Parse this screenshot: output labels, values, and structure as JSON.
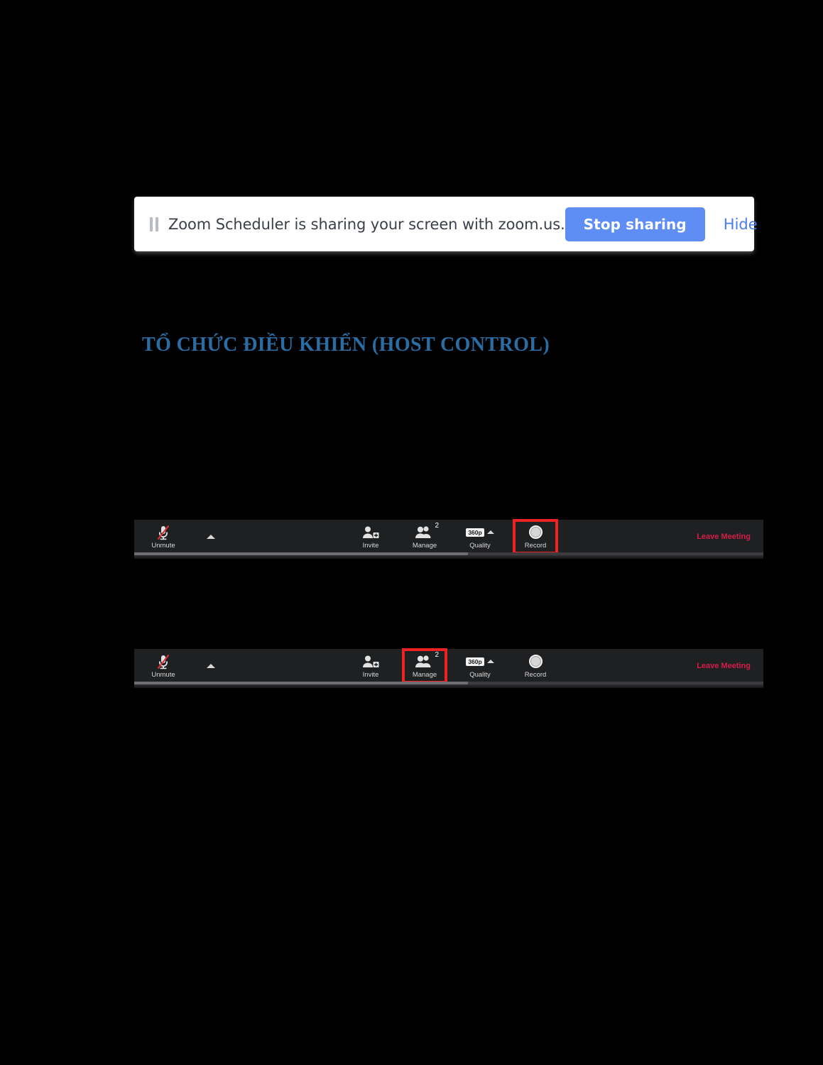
{
  "share_banner": {
    "pause_icon": "pause-icon",
    "message": "Zoom Scheduler is sharing your screen with zoom.us.",
    "stop_label": "Stop sharing",
    "hide_label": "Hide",
    "button_color": "#5e8df4",
    "link_color": "#4b7cf0"
  },
  "heading": {
    "text": "TỔ CHỨC ĐIỀU KHIỂN (HOST CONTROL)",
    "color": "#2b6ca3"
  },
  "toolbars": [
    {
      "id": "toolbar-record-highlighted",
      "highlighted": "Record",
      "items": [
        {
          "label": "Unmute",
          "icon": "microphone-muted-icon"
        },
        {
          "label": "Invite",
          "icon": "person-add-icon"
        },
        {
          "label": "Manage",
          "icon": "participants-icon",
          "badge": "2"
        },
        {
          "label": "Quality",
          "icon": "quality-icon",
          "value": "360p"
        },
        {
          "label": "Record",
          "icon": "record-icon"
        }
      ],
      "leave_label": "Leave Meeting",
      "leave_color": "#d31e4a",
      "highlight_color": "#ee2222"
    },
    {
      "id": "toolbar-manage-highlighted",
      "highlighted": "Manage",
      "items": [
        {
          "label": "Unmute",
          "icon": "microphone-muted-icon"
        },
        {
          "label": "Invite",
          "icon": "person-add-icon"
        },
        {
          "label": "Manage",
          "icon": "participants-icon",
          "badge": "2"
        },
        {
          "label": "Quality",
          "icon": "quality-icon",
          "value": "360p"
        },
        {
          "label": "Record",
          "icon": "record-icon"
        }
      ],
      "leave_label": "Leave Meeting",
      "leave_color": "#d31e4a",
      "highlight_color": "#ee2222"
    }
  ]
}
